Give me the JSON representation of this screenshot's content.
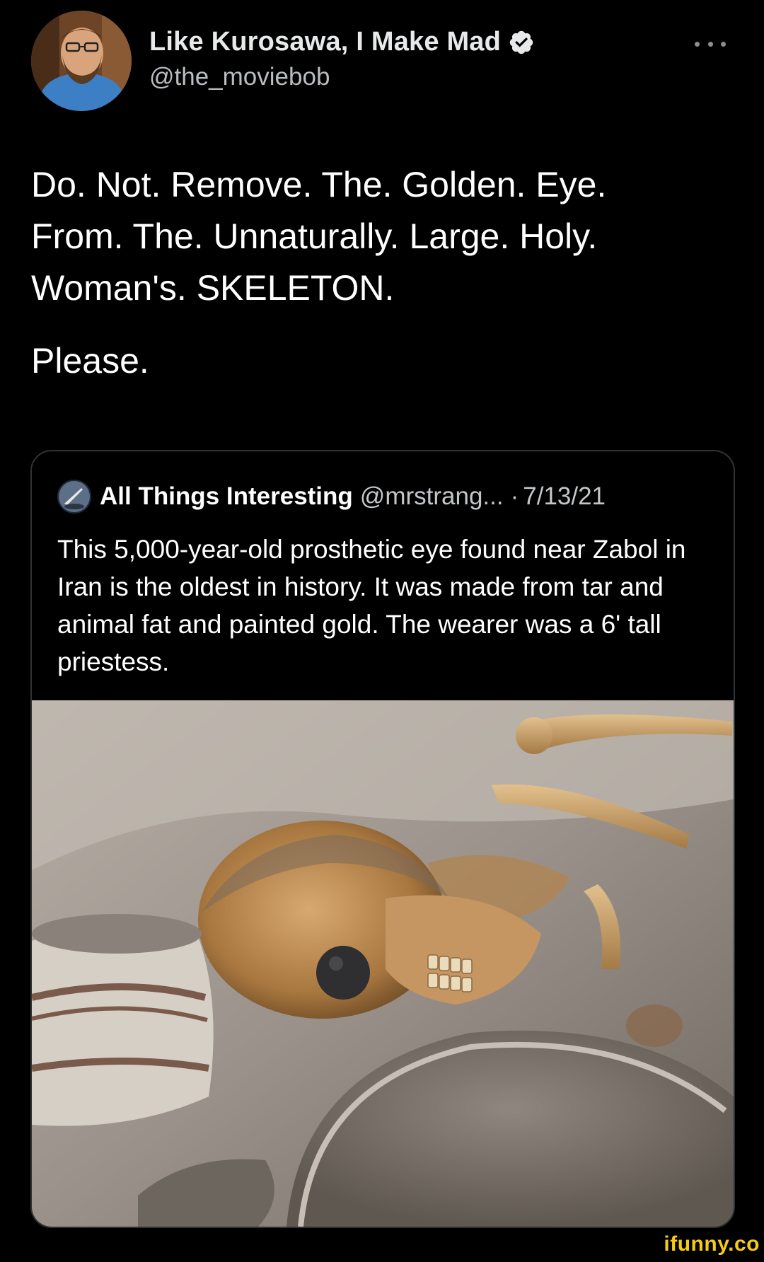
{
  "tweet": {
    "author": {
      "display_name": "Like Kurosawa, I Make Mad",
      "handle": "@the_moviebob",
      "verified": true,
      "verified_icon": "verified-badge-icon",
      "avatar": "profile-photo"
    },
    "more_icon": "more-dots-icon",
    "text_lines": [
      "Do. Not. Remove. The. Golden. Eye.",
      "From. The. Unnaturally. Large. Holy.",
      "Woman's. SKELETON."
    ],
    "text_last": "Please."
  },
  "quote": {
    "author_name": "All Things Interesting",
    "handle": "@mrstrang...",
    "separator": "·",
    "date": "7/13/21",
    "text": "This 5,000-year-old prosthetic eye found near Zabol in Iran is the oldest in history. It was made from tar and animal fat and painted gold. The wearer was a 6' tall priestess.",
    "image": "excavated-skeleton-photo"
  },
  "watermark": "ifunny.co",
  "colors": {
    "background": "#000000",
    "text": "#e7e9ea",
    "secondary": "#b9bcc0",
    "border": "#2f3336",
    "verified": "#e7e9ea",
    "watermark": "#f6cb13"
  }
}
